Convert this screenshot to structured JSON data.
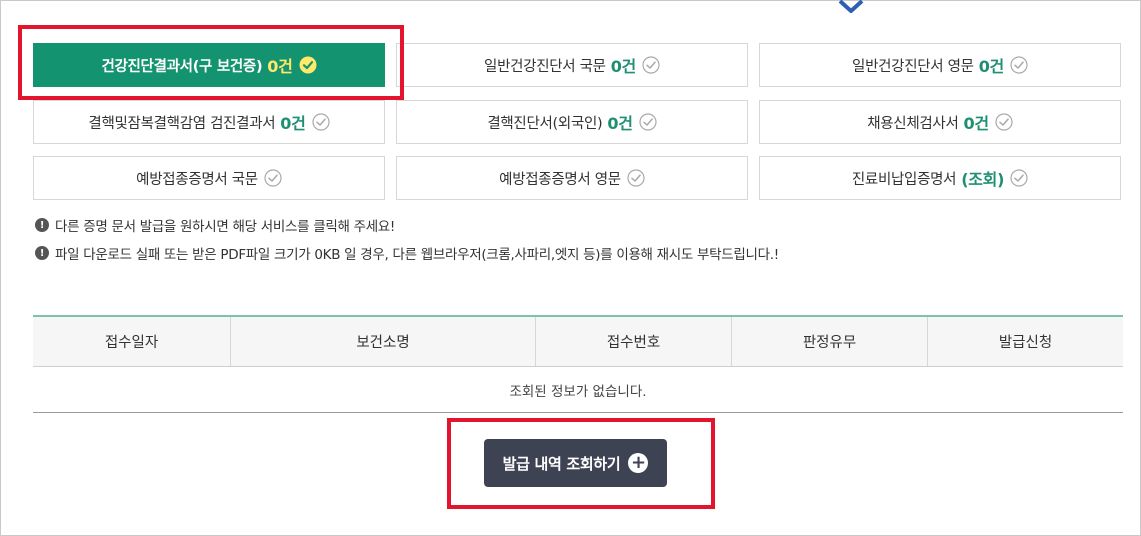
{
  "certificates": [
    {
      "label": "건강진단결과서(구 보건증)",
      "count": "0건",
      "active": true
    },
    {
      "label": "일반건강진단서 국문",
      "count": "0건",
      "active": false
    },
    {
      "label": "일반건강진단서 영문",
      "count": "0건",
      "active": false
    },
    {
      "label": "결핵및잠복결핵감염 검진결과서",
      "count": "0건",
      "active": false
    },
    {
      "label": "결핵진단서(외국인)",
      "count": "0건",
      "active": false
    },
    {
      "label": "채용신체검사서",
      "count": "0건",
      "active": false
    },
    {
      "label": "예방접종증명서 국문",
      "count": "",
      "active": false
    },
    {
      "label": "예방접종증명서 영문",
      "count": "",
      "active": false
    },
    {
      "label": "진료비납입증명서",
      "count": "(조회)",
      "active": false
    }
  ],
  "notices": [
    "다른 증명 문서 발급을 원하시면 해당 서비스를 클릭해 주세요!",
    "파일 다운로드 실패 또는 받은 PDF파일 크기가 0KB 일 경우, 다른 웹브라우저(크롬,사파리,엣지 등)를 이용해 재시도 부탁드립니다.!"
  ],
  "table": {
    "headers": [
      "접수일자",
      "보건소명",
      "접수번호",
      "판정유무",
      "발급신청"
    ],
    "empty_message": "조회된 정보가 없습니다."
  },
  "button": {
    "label": "발급 내역 조회하기"
  },
  "colors": {
    "primary_green": "#13936f",
    "count_green": "#1f8f74",
    "count_active": "#ffe96a",
    "button_dark": "#3e4353",
    "highlight_red": "#e3152e",
    "chevron_blue": "#2d5fb4"
  }
}
